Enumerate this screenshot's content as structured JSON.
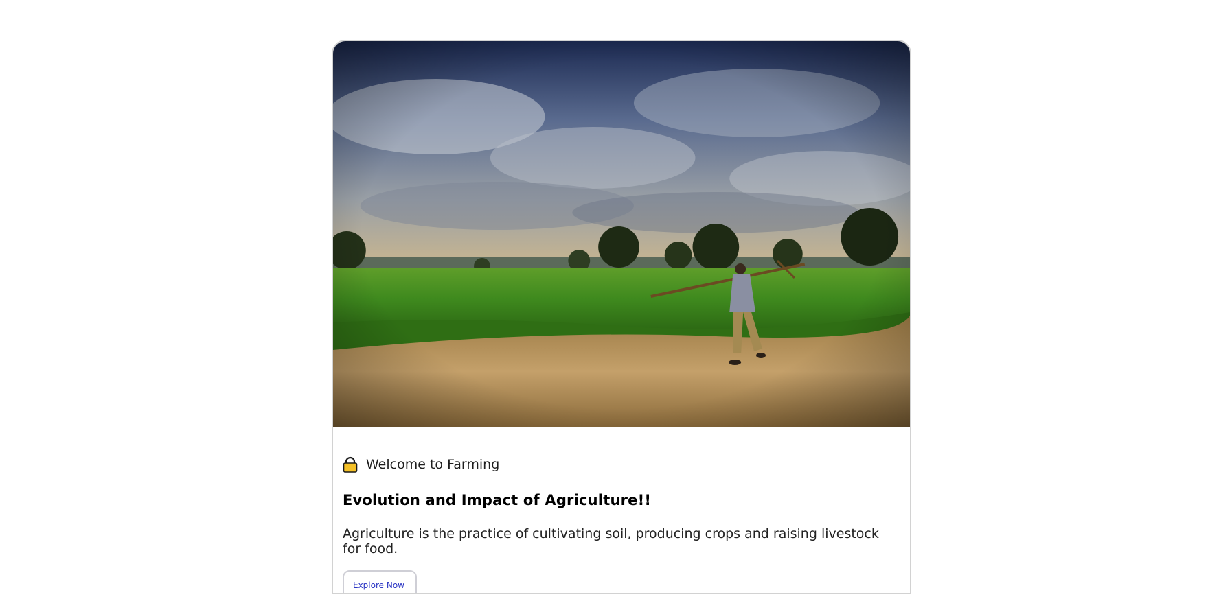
{
  "card": {
    "eyebrow_icon": "lock-icon",
    "eyebrow": "Welcome to Farming",
    "title": "Evolution and Impact of Agriculture!!",
    "description": "Agriculture is the practice of cultivating soil, producing crops and raising livestock for food.",
    "button_label": "Explore Now"
  },
  "colors": {
    "accent": "#2b35c4",
    "lock": "#f4c027",
    "border": "#d2d2d2"
  }
}
